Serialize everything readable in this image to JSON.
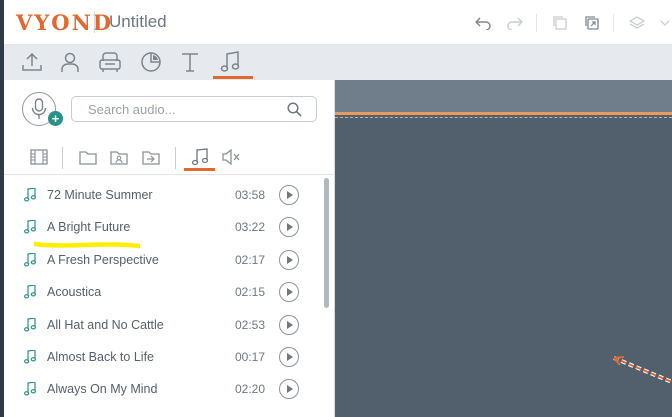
{
  "app": {
    "logo": "VYOND",
    "title": "Untitled"
  },
  "header_icons": [
    "undo-icon",
    "redo-icon",
    "copy-icon",
    "duplicate-icon",
    "layers-icon"
  ],
  "tool_tabs": [
    {
      "name": "upload-icon",
      "active": false
    },
    {
      "name": "character-icon",
      "active": false
    },
    {
      "name": "prop-icon",
      "active": false
    },
    {
      "name": "chart-icon",
      "active": false
    },
    {
      "name": "text-icon",
      "active": false
    },
    {
      "name": "audio-icon",
      "active": true
    }
  ],
  "search": {
    "placeholder": "Search audio..."
  },
  "sub_tabs": [
    "video-icon",
    "folder-icon",
    "shared-folder-icon",
    "import-icon",
    "music-icon",
    "sound-effect-icon"
  ],
  "tracks": [
    {
      "name": "72 Minute Summer",
      "duration": "03:58"
    },
    {
      "name": "A Bright Future",
      "duration": "03:22"
    },
    {
      "name": "A Fresh Perspective",
      "duration": "02:17"
    },
    {
      "name": "Acoustica",
      "duration": "02:15"
    },
    {
      "name": "All Hat and No Cattle",
      "duration": "02:53"
    },
    {
      "name": "Almost Back to Life",
      "duration": "00:17"
    },
    {
      "name": "Always On My Mind",
      "duration": "02:20"
    }
  ],
  "colors": {
    "accent": "#e2682e",
    "teal": "#2b8f8a",
    "stage": "#52606d",
    "highlight": "#ffee00"
  }
}
